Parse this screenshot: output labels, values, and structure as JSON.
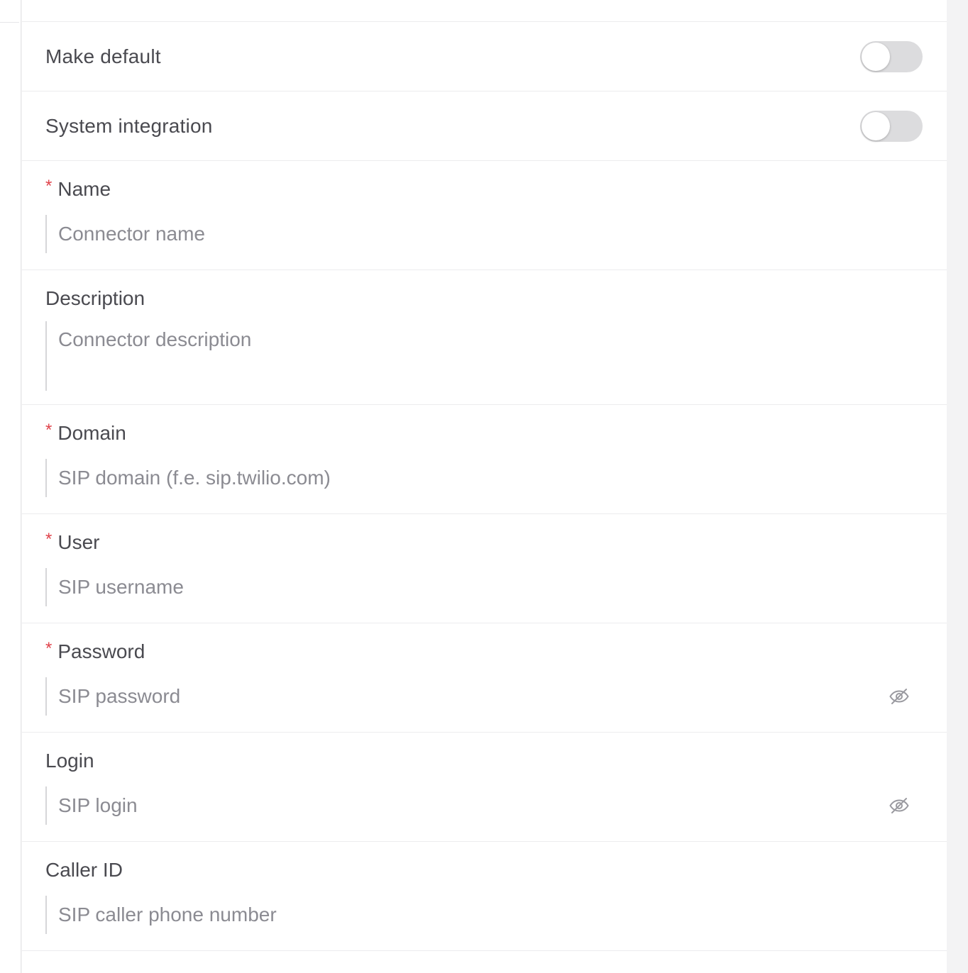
{
  "toggles": [
    {
      "label": "Make default",
      "on": false
    },
    {
      "label": "System integration",
      "on": false
    }
  ],
  "fields": {
    "name": {
      "label": "Name",
      "required": true,
      "placeholder": "Connector name"
    },
    "description": {
      "label": "Description",
      "required": false,
      "placeholder": "Connector description"
    },
    "domain": {
      "label": "Domain",
      "required": true,
      "placeholder": "SIP domain (f.e. sip.twilio.com)"
    },
    "user": {
      "label": "User",
      "required": true,
      "placeholder": "SIP username"
    },
    "password": {
      "label": "Password",
      "required": true,
      "placeholder": "SIP password",
      "icon": "eye-slash-icon"
    },
    "login": {
      "label": "Login",
      "required": false,
      "placeholder": "SIP login",
      "icon": "eye-slash-icon"
    },
    "caller_id": {
      "label": "Caller ID",
      "required": false,
      "placeholder": "SIP caller phone number"
    }
  },
  "required_marker": "*",
  "colors": {
    "required": "#e0434b",
    "label": "#4a4a50",
    "placeholder": "#8b8b92",
    "toggle_off": "#dcdcde"
  }
}
